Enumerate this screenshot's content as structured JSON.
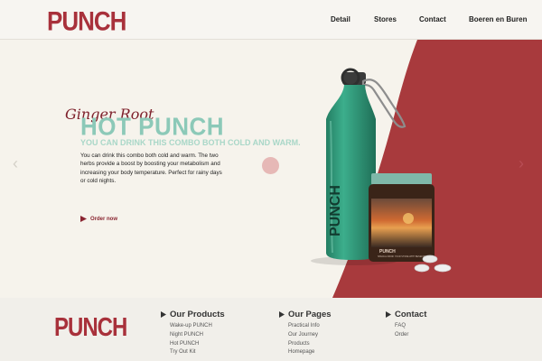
{
  "header": {
    "logo": "PUNCH",
    "nav": [
      "Detail",
      "Stores",
      "Contact",
      "Boeren en Buren"
    ]
  },
  "hero": {
    "kicker": "Ginger Root",
    "headline": "HOT PUNCH",
    "subhead": "YOU CAN DRINK THIS COMBO BOTH COLD AND WARM.",
    "body": "You can drink this combo both cold and warm. The two herbs provide a boost by boosting your metabolism and increasing your body temperature. Perfect for rainy days or cold nights.",
    "cta": "Order now",
    "bottle_brand": "PUNCH",
    "jar_brand": "PUNCH",
    "jar_tagline": "SPECIAL DRINK YOUR STORE WITH BENEFITS"
  },
  "footer": {
    "logo": "PUNCH",
    "columns": [
      {
        "title": "Our Products",
        "items": [
          "Wake-up PUNCH",
          "Night PUNCH",
          "Hot PUNCH",
          "Try Out Kit"
        ]
      },
      {
        "title": "Our Pages",
        "items": [
          "Practical Info",
          "Our Journey",
          "Products",
          "Homepage"
        ]
      },
      {
        "title": "Contact",
        "items": [
          "FAQ",
          "Order"
        ]
      }
    ]
  },
  "colors": {
    "brand_red": "#a8313b",
    "panel_red": "#a83a3d",
    "mint": "#8cc9b8",
    "bottle_teal": "#2e9878",
    "background": "#f6f3ec"
  },
  "icons": {
    "prev": "chevron-left-icon",
    "next": "chevron-right-icon",
    "cta": "play-triangle-icon",
    "footer_heading": "play-triangle-icon"
  }
}
